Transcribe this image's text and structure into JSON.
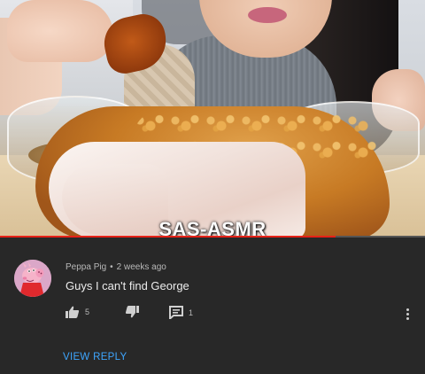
{
  "video": {
    "watermark": "SAS-ASMR",
    "progress": 0.79,
    "progress_color": "#e62117"
  },
  "comment": {
    "author": "Peppa Pig",
    "separator": "•",
    "time": "2 weeks ago",
    "text": "Guys I can't find George",
    "avatar_icon": "peppa-pig-avatar",
    "like_icon": "thumbs-up-icon",
    "like_count": "5",
    "dislike_icon": "thumbs-down-icon",
    "reply_icon": "reply-comment-icon",
    "reply_count": "1",
    "more_icon": "more-vertical-icon",
    "view_reply_label": "VIEW REPLY",
    "link_color": "#3ea6ff"
  }
}
